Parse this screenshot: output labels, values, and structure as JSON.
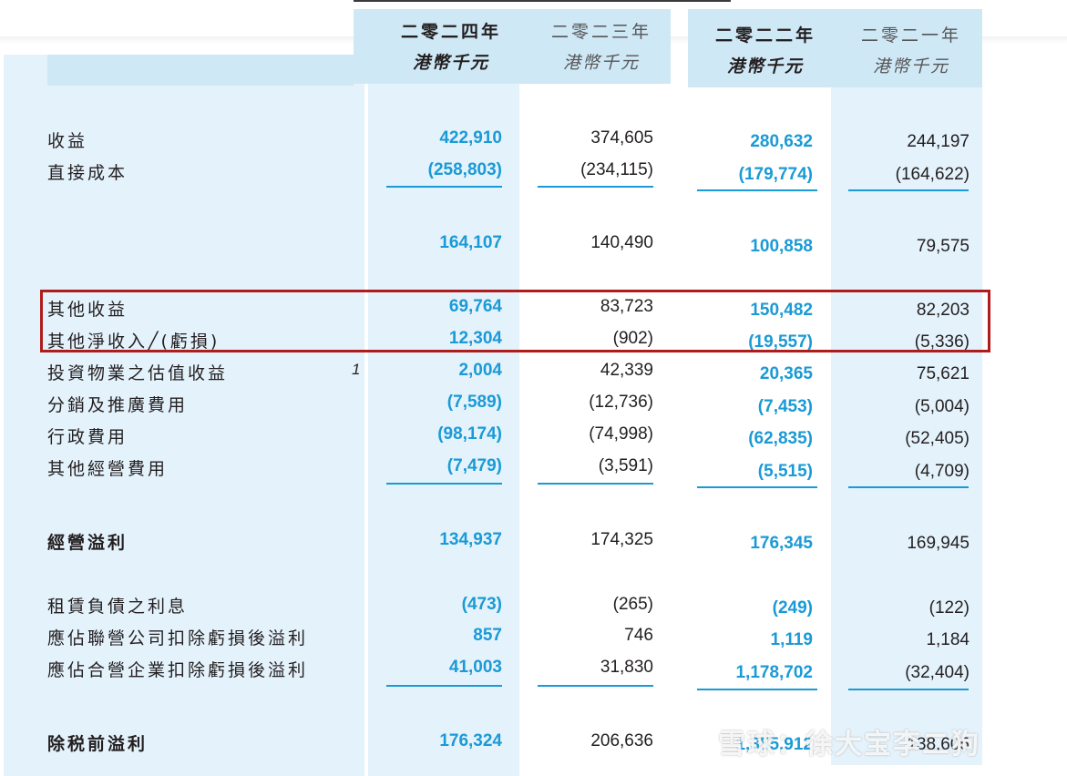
{
  "header": {
    "y2024": "二零二四年",
    "y2023": "二零二三年",
    "y2022": "二零二二年",
    "y2021": "二零二一年",
    "unit": "港幣千元"
  },
  "rows": [
    {
      "label": "收益",
      "v": [
        "422,910",
        "374,605",
        "280,632",
        "244,197"
      ]
    },
    {
      "label": "直接成本",
      "v": [
        "(258,803)",
        "(234,115)",
        "(179,774)",
        "(164,622)"
      ]
    },
    {
      "label": "",
      "v": [
        "164,107",
        "140,490",
        "100,858",
        "79,575"
      ]
    },
    {
      "label": "其他收益",
      "v": [
        "69,764",
        "83,723",
        "150,482",
        "82,203"
      ]
    },
    {
      "label": "其他淨收入╱(虧損)",
      "v": [
        "12,304",
        "(902)",
        "(19,557)",
        "(5,336)"
      ]
    },
    {
      "label": "投資物業之估值收益",
      "note": "1",
      "v": [
        "2,004",
        "42,339",
        "20,365",
        "75,621"
      ]
    },
    {
      "label": "分銷及推廣費用",
      "v": [
        "(7,589)",
        "(12,736)",
        "(7,453)",
        "(5,004)"
      ]
    },
    {
      "label": "行政費用",
      "v": [
        "(98,174)",
        "(74,998)",
        "(62,835)",
        "(52,405)"
      ]
    },
    {
      "label": "其他經營費用",
      "v": [
        "(7,479)",
        "(3,591)",
        "(5,515)",
        "(4,709)"
      ]
    },
    {
      "label": "經營溢利",
      "v": [
        "134,937",
        "174,325",
        "176,345",
        "169,945"
      ]
    },
    {
      "label": "租賃負債之利息",
      "v": [
        "(473)",
        "(265)",
        "(249)",
        "(122)"
      ]
    },
    {
      "label": "應佔聯營公司扣除虧損後溢利",
      "v": [
        "857",
        "746",
        "1,119",
        "1,184"
      ]
    },
    {
      "label": "應佔合營企業扣除虧損後溢利",
      "v": [
        "41,003",
        "31,830",
        "1,178,702",
        "(32,404)"
      ]
    },
    {
      "label": "除税前溢利",
      "v": [
        "176,324",
        "206,636",
        "1,355,912",
        "138,605"
      ]
    }
  ],
  "watermark": "雪球：徐大宝李二狗",
  "colors": {
    "accent": "#1a9ad6",
    "band": "#e4f2fb",
    "header_band": "#cfe8f6",
    "highlight": "#b01c1c"
  }
}
